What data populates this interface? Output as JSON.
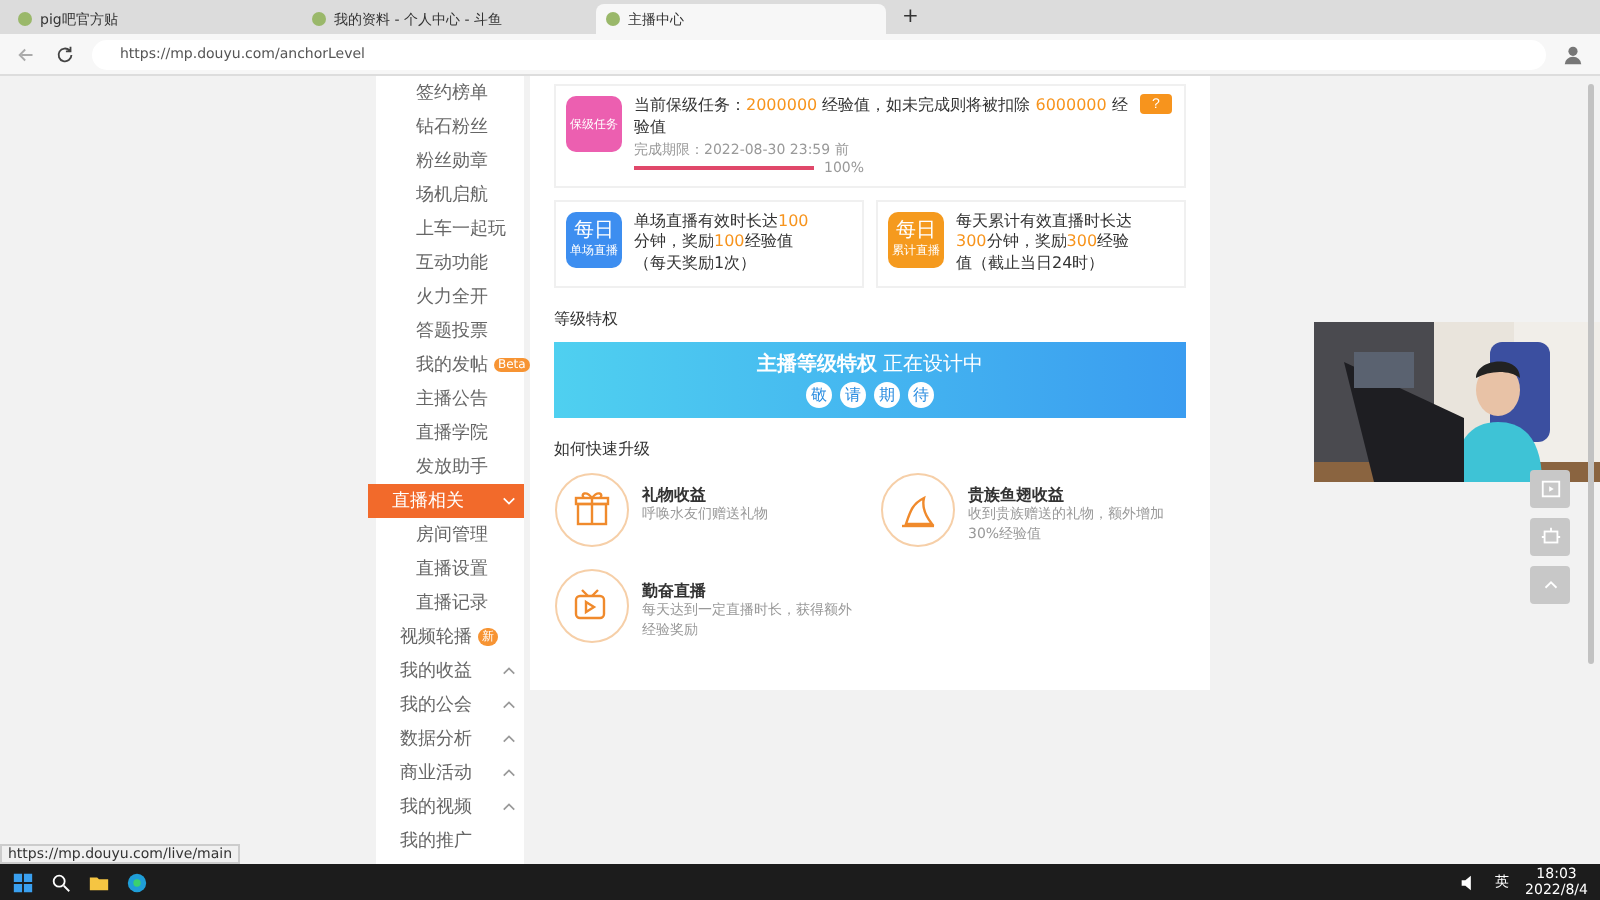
{
  "browser": {
    "tabs": [
      {
        "title": "pig吧官方贴",
        "selected": false
      },
      {
        "title": "我的资料 - 个人中心 - 斗鱼",
        "selected": false
      },
      {
        "title": "主播中心",
        "selected": true
      }
    ],
    "new_tab": "+",
    "url": "https://mp.douyu.com/anchorLevel"
  },
  "sidebar": {
    "items": [
      {
        "label": "签约榜单",
        "kind": "sub",
        "selected": false
      },
      {
        "label": "钻石粉丝",
        "kind": "sub",
        "selected": false
      },
      {
        "label": "粉丝勋章",
        "kind": "sub",
        "selected": false
      },
      {
        "label": "场机启航",
        "kind": "sub",
        "selected": false
      },
      {
        "label": "上车一起玩",
        "kind": "sub",
        "selected": false
      },
      {
        "label": "互动功能",
        "kind": "sub",
        "selected": false
      },
      {
        "label": "火力全开",
        "kind": "sub",
        "selected": false
      },
      {
        "label": "答题投票",
        "kind": "sub",
        "selected": false
      },
      {
        "label": "我的发帖",
        "kind": "sub",
        "selected": false,
        "badge": "Beta"
      },
      {
        "label": "主播公告",
        "kind": "sub",
        "selected": false
      },
      {
        "label": "直播学院",
        "kind": "sub",
        "selected": false
      },
      {
        "label": "发放助手",
        "kind": "sub",
        "selected": false
      },
      {
        "label": "直播相关",
        "kind": "group",
        "selected": true,
        "expanded": true
      },
      {
        "label": "房间管理",
        "kind": "sub",
        "selected": false
      },
      {
        "label": "直播设置",
        "kind": "sub",
        "selected": false
      },
      {
        "label": "直播记录",
        "kind": "sub",
        "selected": false
      },
      {
        "label": "视频轮播",
        "kind": "group",
        "selected": false,
        "badge": "新"
      },
      {
        "label": "我的收益",
        "kind": "group",
        "selected": false,
        "expanded": false
      },
      {
        "label": "我的公会",
        "kind": "group",
        "selected": false,
        "expanded": false
      },
      {
        "label": "数据分析",
        "kind": "group",
        "selected": false,
        "expanded": false
      },
      {
        "label": "商业活动",
        "kind": "group",
        "selected": false,
        "expanded": false
      },
      {
        "label": "我的视频",
        "kind": "group",
        "selected": false,
        "expanded": false
      },
      {
        "label": "我的推广",
        "kind": "group",
        "selected": false
      }
    ]
  },
  "keep_task": {
    "badge": "保级任务",
    "text": [
      {
        "text": "当前保级任务：",
        "highlight": false
      },
      {
        "text": "2000000",
        "highlight": true
      },
      {
        "text": " 经验值，如未完成则将被扣除 ",
        "highlight": false
      },
      {
        "text": "6000000",
        "highlight": true
      },
      {
        "text": " 经验值",
        "highlight": false
      }
    ],
    "deadline": "完成期限：2022-08-30 23:59 前",
    "level": 1,
    "reading": "100%",
    "help": "?"
  },
  "daily_tasks": [
    {
      "badge_title": "每日",
      "badge_sub": "单场直播",
      "color": "#3d8ef0",
      "text": [
        {
          "text": "单场直播有效时长达",
          "highlight": false
        },
        {
          "text": "100",
          "highlight": true
        },
        {
          "text": "分钟，奖励",
          "highlight": false
        },
        {
          "text": "100",
          "highlight": true
        },
        {
          "text": "经验值（每天奖励1次）",
          "highlight": false
        }
      ]
    },
    {
      "badge_title": "每日",
      "badge_sub": "累计直播",
      "color": "#f59a1e",
      "text": [
        {
          "text": "每天累计有效直播时长达",
          "highlight": false
        },
        {
          "text": "300",
          "highlight": true
        },
        {
          "text": "分钟，奖励",
          "highlight": false
        },
        {
          "text": "300",
          "highlight": true
        },
        {
          "text": "经验值（截止当日24时）",
          "highlight": false
        }
      ]
    }
  ],
  "privileges": {
    "heading": "等级特权",
    "banner_title": "主播等级特权",
    "banner_rest": "正在设计中",
    "banner_chips": [
      "敬",
      "请",
      "期",
      "待"
    ]
  },
  "tips": {
    "heading": "如何快速升级",
    "items": [
      {
        "kind": "gift",
        "title": "礼物收益",
        "desc": "呼唤水友们赠送礼物"
      },
      {
        "kind": "fin",
        "title": "贵族鱼翅收益",
        "desc": "收到贵族赠送的礼物，额外增加30%经验值"
      },
      {
        "kind": "live",
        "title": "勤奋直播",
        "desc": "每天达到一定直播时长，获得额外经验奖励"
      }
    ]
  },
  "status_url": "https://mp.douyu.com/live/main",
  "taskbar": {
    "ime": "英",
    "time": "18:03",
    "date": "2022/8/4"
  }
}
